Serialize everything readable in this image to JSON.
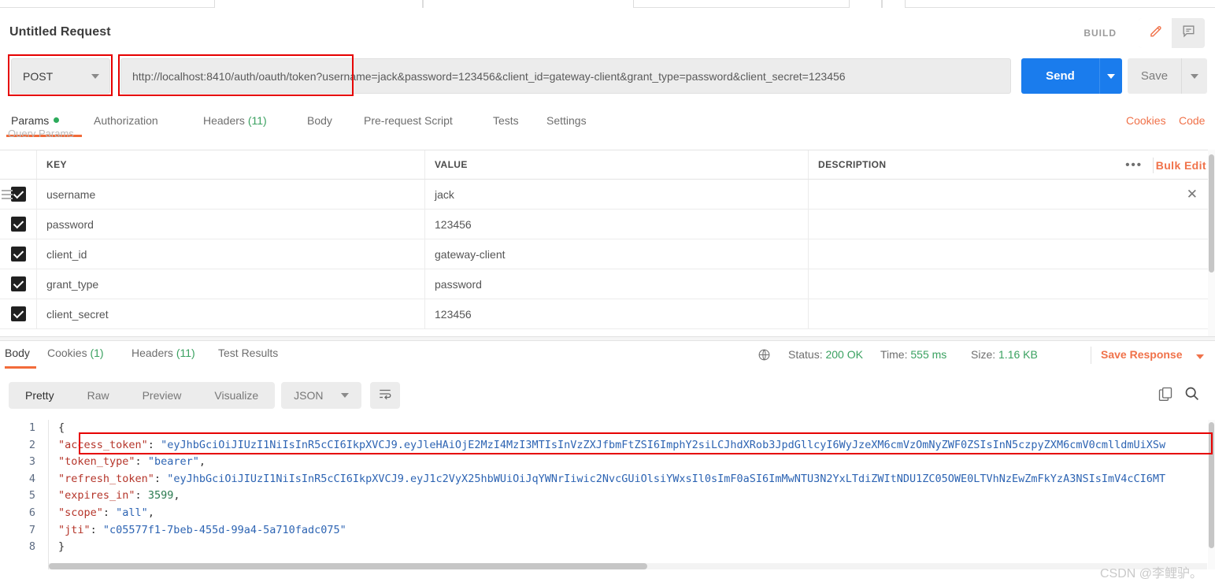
{
  "window": {
    "request_title": "Untitled Request",
    "build_label": "BUILD",
    "edit_icon": "pencil-icon",
    "comment_icon": "comment-icon"
  },
  "request": {
    "method": "POST",
    "url": "http://localhost:8410/auth/oauth/token?username=jack&password=123456&client_id=gateway-client&grant_type=password&client_secret=123456",
    "send_label": "Send",
    "save_label": "Save",
    "tabs": [
      {
        "label": "Params",
        "badge": "dot",
        "active": true
      },
      {
        "label": "Authorization",
        "badge": "",
        "active": false
      },
      {
        "label": "Headers",
        "badge": "(11)",
        "active": false
      },
      {
        "label": "Body",
        "badge": "",
        "active": false
      },
      {
        "label": "Pre-request Script",
        "badge": "",
        "active": false
      },
      {
        "label": "Tests",
        "badge": "",
        "active": false
      },
      {
        "label": "Settings",
        "badge": "",
        "active": false
      }
    ],
    "cookies_link": "Cookies",
    "code_link": "Code",
    "section_ghost": "Query Params"
  },
  "params_table": {
    "headers": {
      "key": "KEY",
      "value": "VALUE",
      "description": "DESCRIPTION"
    },
    "bulk_edit": "Bulk Edit",
    "more_dots": "•••",
    "rows": [
      {
        "checked": true,
        "key": "username",
        "value": "jack",
        "description": "",
        "has_close": true
      },
      {
        "checked": true,
        "key": "password",
        "value": "123456",
        "description": "",
        "has_close": false
      },
      {
        "checked": true,
        "key": "client_id",
        "value": "gateway-client",
        "description": "",
        "has_close": false
      },
      {
        "checked": true,
        "key": "grant_type",
        "value": "password",
        "description": "",
        "has_close": false
      },
      {
        "checked": true,
        "key": "client_secret",
        "value": "123456",
        "description": "",
        "has_close": false
      }
    ]
  },
  "response": {
    "tabs": [
      {
        "label": "Body",
        "badge": "",
        "active": true
      },
      {
        "label": "Cookies",
        "badge": "(1)",
        "active": false
      },
      {
        "label": "Headers",
        "badge": "(11)",
        "active": false
      },
      {
        "label": "Test Results",
        "badge": "",
        "active": false
      }
    ],
    "globe_icon": "globe-icon",
    "status_label": "Status:",
    "status_value": "200 OK",
    "time_label": "Time:",
    "time_value": "555 ms",
    "size_label": "Size:",
    "size_value": "1.16 KB",
    "save_response": "Save Response",
    "view_modes": [
      {
        "label": "Pretty",
        "active": true
      },
      {
        "label": "Raw",
        "active": false
      },
      {
        "label": "Preview",
        "active": false
      },
      {
        "label": "Visualize",
        "active": false
      }
    ],
    "format": "JSON",
    "wrap_icon": "word-wrap-icon",
    "copy_icon": "copy-icon",
    "search_icon": "search-icon",
    "line_numbers": [
      "1",
      "2",
      "3",
      "4",
      "5",
      "6",
      "7",
      "8"
    ],
    "json_lines": [
      [
        {
          "t": "{",
          "c": "p"
        }
      ],
      [
        {
          "t": "    \"access_token\"",
          "c": "k"
        },
        {
          "t": ": ",
          "c": "p"
        },
        {
          "t": "\"eyJhbGciOiJIUzI1NiIsInR5cCI6IkpXVCJ9.eyJleHAiOjE2MzI4MzI3MTIsInVzZXJfbmFtZSI6ImphY2siLCJhdXRob3JpdGllcyI6WyJzeXM6cmVzOmNyZWF0ZSIsInN5czpyZXM6cmV0cmlldmUiXSw",
          "c": "s"
        }
      ],
      [
        {
          "t": "    \"token_type\"",
          "c": "k"
        },
        {
          "t": ": ",
          "c": "p"
        },
        {
          "t": "\"bearer\"",
          "c": "s"
        },
        {
          "t": ",",
          "c": "p"
        }
      ],
      [
        {
          "t": "    \"refresh_token\"",
          "c": "k"
        },
        {
          "t": ": ",
          "c": "p"
        },
        {
          "t": "\"eyJhbGciOiJIUzI1NiIsInR5cCI6IkpXVCJ9.eyJ1c2VyX25hbWUiOiJqYWNrIiwic2NvcGUiOlsiYWxsIl0sImF0aSI6ImMwNTU3N2YxLTdiZWItNDU1ZC05OWE0LTVhNzEwZmFkYzA3NSIsImV4cCI6MT",
          "c": "s"
        }
      ],
      [
        {
          "t": "    \"expires_in\"",
          "c": "k"
        },
        {
          "t": ": ",
          "c": "p"
        },
        {
          "t": "3599",
          "c": "n"
        },
        {
          "t": ",",
          "c": "p"
        }
      ],
      [
        {
          "t": "    \"scope\"",
          "c": "k"
        },
        {
          "t": ": ",
          "c": "p"
        },
        {
          "t": "\"all\"",
          "c": "s"
        },
        {
          "t": ",",
          "c": "p"
        }
      ],
      [
        {
          "t": "    \"jti\"",
          "c": "k"
        },
        {
          "t": ": ",
          "c": "p"
        },
        {
          "t": "\"c05577f1-7beb-455d-99a4-5a710fadc075\"",
          "c": "s"
        }
      ],
      [
        {
          "t": "}",
          "c": "p"
        }
      ]
    ]
  },
  "watermark": "CSDN @李鲤驴。",
  "colors": {
    "accent_orange": "#f0724a",
    "send_blue": "#1a7ced",
    "status_green": "#3aa160",
    "highlight_red": "#e60000"
  }
}
